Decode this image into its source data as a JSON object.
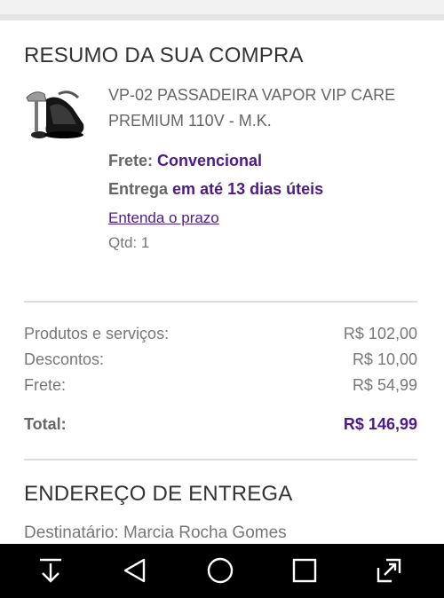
{
  "summary": {
    "title": "RESUMO DA SUA COMPRA",
    "product_name": "VP-02 PASSADEIRA VAPOR VIP CARE PREMIUM 110V - M.K.",
    "shipping_label": "Frete:",
    "shipping_value": "Convencional",
    "delivery_label": "Entrega",
    "delivery_value": "em até 13 dias úteis",
    "deadline_link": "Entenda o prazo",
    "quantity": "Qtd: 1"
  },
  "totals": {
    "products_label": "Produtos e serviços:",
    "products_value": "R$ 102,00",
    "discount_label": "Descontos:",
    "discount_value": "R$ 10,00",
    "freight_label": "Frete:",
    "freight_value": "R$ 54,99",
    "total_label": "Total:",
    "total_value": "R$ 146,99"
  },
  "address": {
    "title": "ENDEREÇO DE ENTREGA",
    "recipient": "Destinatário: Marcia Rocha Gomes"
  },
  "navbar": {
    "icons": [
      "download-icon",
      "back-triangle-icon",
      "home-circle-icon",
      "recents-square-icon",
      "expand-icon"
    ]
  },
  "colors": {
    "accent": "#4b1b8a",
    "navbar_bg": "#000000"
  }
}
